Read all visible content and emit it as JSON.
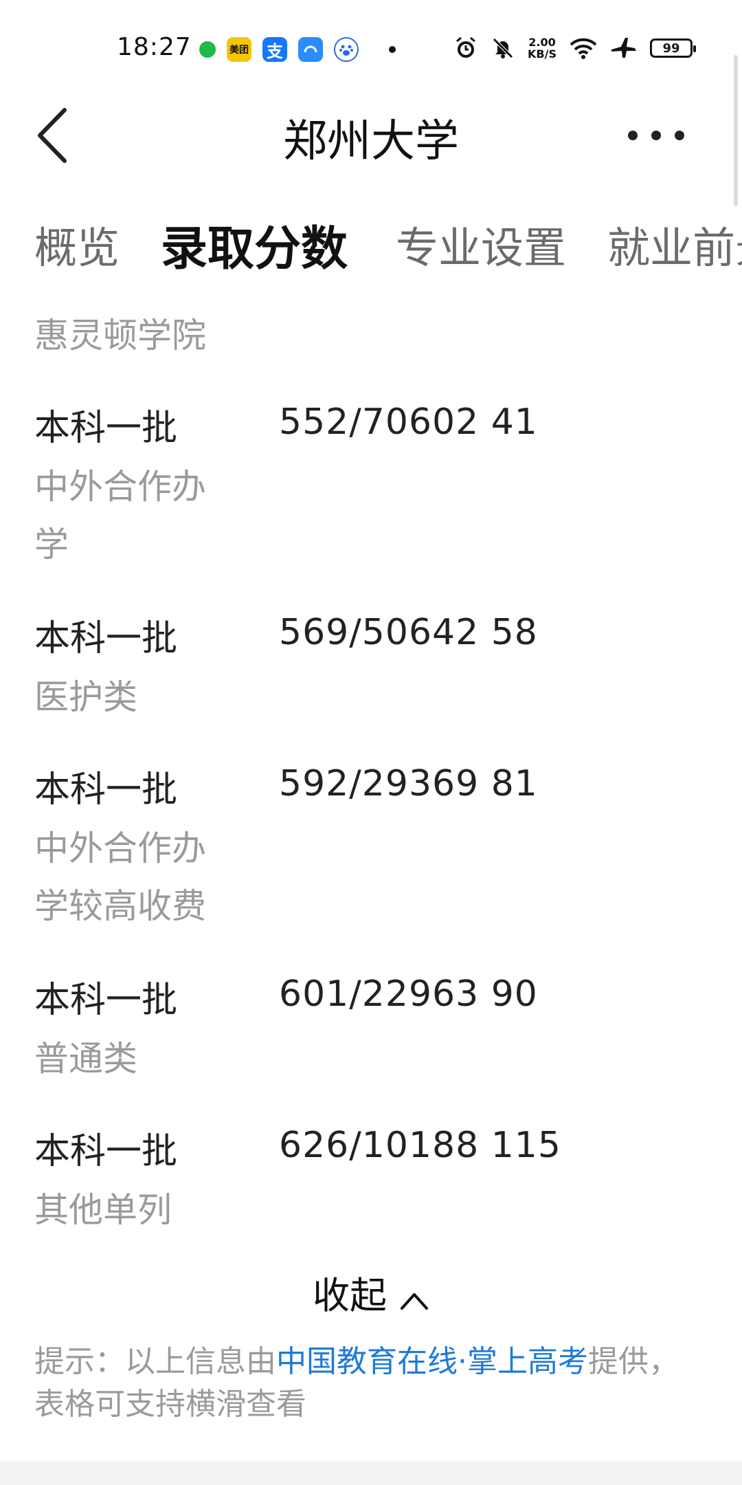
{
  "status_bar": {
    "time": "18:27",
    "apps": [
      "wechat-dot",
      "meituan",
      "alipay",
      "blue-app",
      "baidu"
    ],
    "meituan_label": "美团",
    "alipay_label": "支",
    "net_speed_value": "2.00",
    "net_speed_unit": "KB/S",
    "battery": "99"
  },
  "header": {
    "title": "郑州大学"
  },
  "tabs": [
    {
      "label": "概览",
      "active": false
    },
    {
      "label": "录取分数",
      "active": true
    },
    {
      "label": "专业设置",
      "active": false
    },
    {
      "label": "就业前景",
      "active": false
    }
  ],
  "table": {
    "cut_off_label": "惠灵顿学院",
    "rows": [
      {
        "batch": "本科一批",
        "category": "中外合作办学",
        "score": "552/70602 41"
      },
      {
        "batch": "本科一批",
        "category": "医护类",
        "score": "569/50642 58"
      },
      {
        "batch": "本科一批",
        "category": "中外合作办学较高收费",
        "score": "592/29369 81"
      },
      {
        "batch": "本科一批",
        "category": "普通类",
        "score": "601/22963 90"
      },
      {
        "batch": "本科一批",
        "category": "其他单列",
        "score": "626/10188 115"
      }
    ]
  },
  "collapse": {
    "label": "收起"
  },
  "hint": {
    "prefix": "提示：以上信息由",
    "link": "中国教育在线·掌上高考",
    "suffix": "提供，表格可支持横滑查看"
  },
  "colors": {
    "link": "#1f7ad6",
    "muted": "#9a9a9a",
    "text": "#222222"
  }
}
